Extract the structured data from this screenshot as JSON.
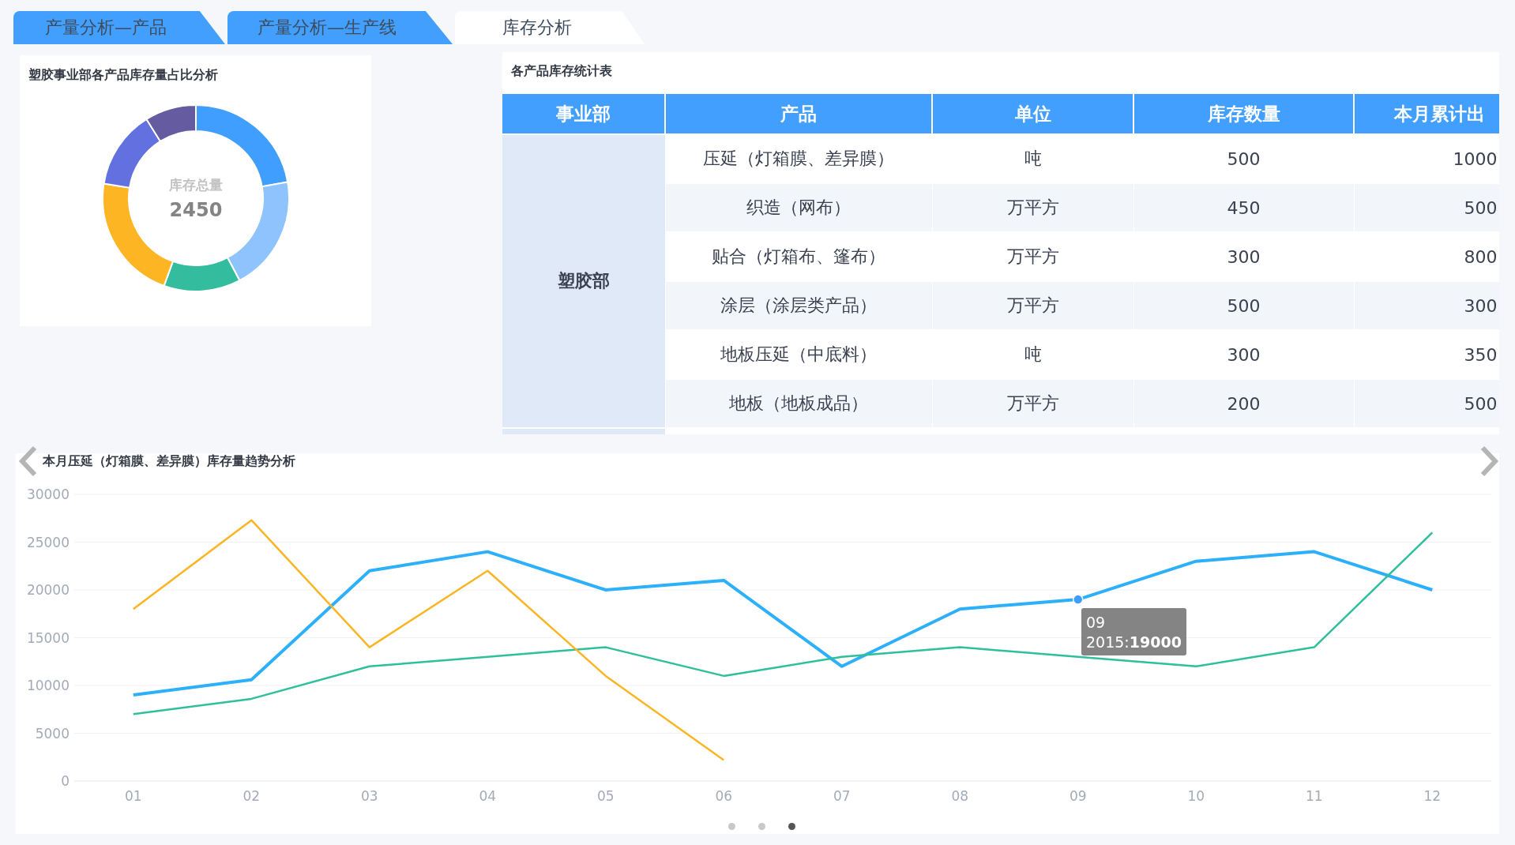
{
  "tabs": [
    {
      "label": "产量分析—产品",
      "selected": false
    },
    {
      "label": "产量分析—生产线",
      "selected": false
    },
    {
      "label": "库存分析",
      "selected": true
    }
  ],
  "donut_panel": {
    "title": "塑胶事业部各产品库存量占比分析",
    "center_label": "库存总量",
    "center_value": "2450"
  },
  "table_panel": {
    "title": "各产品库存统计表",
    "columns": [
      "事业部",
      "产品",
      "单位",
      "库存数量",
      "本月累计出"
    ],
    "groups": [
      {
        "department": "塑胶部",
        "rows": [
          {
            "product": "压延（灯箱膜、差异膜）",
            "unit": "吨",
            "stock": "500",
            "month_out": "1000"
          },
          {
            "product": "织造（网布）",
            "unit": "万平方",
            "stock": "450",
            "month_out": "500"
          },
          {
            "product": "贴合（灯箱布、篷布）",
            "unit": "万平方",
            "stock": "300",
            "month_out": "800"
          },
          {
            "product": "涂层（涂层类产品）",
            "unit": "万平方",
            "stock": "500",
            "month_out": "300"
          },
          {
            "product": "地板压延（中底料）",
            "unit": "吨",
            "stock": "300",
            "month_out": "350"
          },
          {
            "product": "地板（地板成品）",
            "unit": "万平方",
            "stock": "200",
            "month_out": "500"
          }
        ]
      }
    ]
  },
  "trend_panel": {
    "title": "本月压延（灯箱膜、差异膜）库存量趋势分析",
    "chart_data": {
      "type": "line",
      "categories": [
        "01",
        "02",
        "03",
        "04",
        "05",
        "06",
        "07",
        "08",
        "09",
        "10",
        "11",
        "12"
      ],
      "ylim": [
        0,
        30000
      ],
      "grid": true,
      "yticks": [
        0,
        5000,
        10000,
        15000,
        20000,
        25000,
        30000
      ],
      "series": [
        {
          "color": "#2db0fb",
          "values": [
            9000,
            10600,
            22000,
            24000,
            20000,
            21000,
            12000,
            18000,
            19000,
            23000,
            24000,
            20000
          ]
        },
        {
          "color": "#2fbf9b",
          "values": [
            7000,
            8600,
            12000,
            13000,
            14000,
            11000,
            13000,
            14000,
            13000,
            12000,
            14000,
            26000
          ]
        },
        {
          "color": "#fbb524",
          "values": [
            18000,
            27300,
            14000,
            22000,
            11000,
            2200,
            null,
            null,
            null,
            null,
            null,
            null
          ]
        }
      ]
    },
    "tooltip": {
      "category": "09",
      "text": "2015:**19000**"
    },
    "carousel": {
      "pages": [
        {
          "selected": false
        },
        {
          "selected": false
        },
        {
          "selected": true
        }
      ]
    }
  }
}
